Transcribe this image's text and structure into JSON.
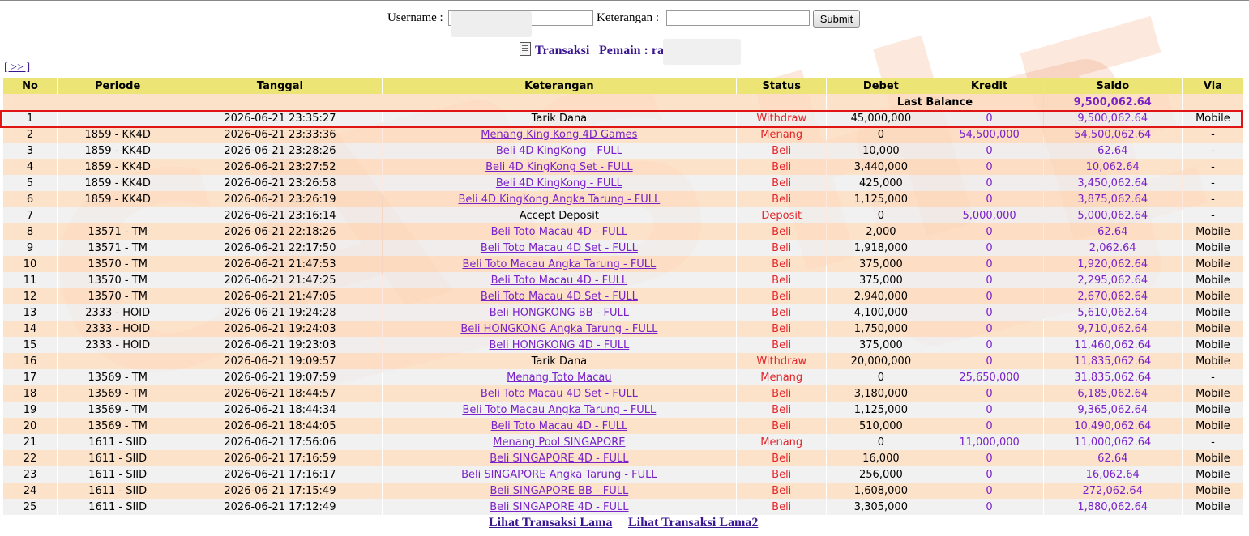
{
  "form": {
    "username_label": "Username :",
    "keterangan_label": "Keterangan :",
    "submit_label": "Submit"
  },
  "heading": {
    "transaksi": "Transaksi",
    "pemain": "Pemain : ra"
  },
  "nav": {
    "next": "[ >> ]"
  },
  "table": {
    "headers": [
      "No",
      "Periode",
      "Tanggal",
      "Keterangan",
      "Status",
      "Debet",
      "Kredit",
      "Saldo",
      "Via"
    ],
    "last_balance_label": "Last Balance",
    "last_balance_value": "9,500,062.64",
    "rows": [
      {
        "no": "1",
        "periode": "",
        "tanggal": "2026-06-21 23:35:27",
        "keterangan": "Tarik Dana",
        "link": false,
        "status": "Withdraw",
        "debet": "45,000,000",
        "kredit": "0",
        "saldo": "9,500,062.64",
        "via": "Mobile"
      },
      {
        "no": "2",
        "periode": "1859 - KK4D",
        "tanggal": "2026-06-21 23:33:36",
        "keterangan": "Menang King Kong 4D Games",
        "link": true,
        "status": "Menang",
        "debet": "0",
        "kredit": "54,500,000",
        "saldo": "54,500,062.64",
        "via": "-"
      },
      {
        "no": "3",
        "periode": "1859 - KK4D",
        "tanggal": "2026-06-21 23:28:26",
        "keterangan": "Beli 4D KingKong - FULL",
        "link": true,
        "status": "Beli",
        "debet": "10,000",
        "kredit": "0",
        "saldo": "62.64",
        "via": "-"
      },
      {
        "no": "4",
        "periode": "1859 - KK4D",
        "tanggal": "2026-06-21 23:27:52",
        "keterangan": "Beli 4D KingKong Set - FULL",
        "link": true,
        "status": "Beli",
        "debet": "3,440,000",
        "kredit": "0",
        "saldo": "10,062.64",
        "via": "-"
      },
      {
        "no": "5",
        "periode": "1859 - KK4D",
        "tanggal": "2026-06-21 23:26:58",
        "keterangan": "Beli 4D KingKong - FULL",
        "link": true,
        "status": "Beli",
        "debet": "425,000",
        "kredit": "0",
        "saldo": "3,450,062.64",
        "via": "-"
      },
      {
        "no": "6",
        "periode": "1859 - KK4D",
        "tanggal": "2026-06-21 23:26:19",
        "keterangan": "Beli 4D KingKong Angka Tarung - FULL",
        "link": true,
        "status": "Beli",
        "debet": "1,125,000",
        "kredit": "0",
        "saldo": "3,875,062.64",
        "via": "-"
      },
      {
        "no": "7",
        "periode": "",
        "tanggal": "2026-06-21 23:16:14",
        "keterangan": "Accept Deposit",
        "link": false,
        "status": "Deposit",
        "debet": "0",
        "kredit": "5,000,000",
        "saldo": "5,000,062.64",
        "via": "-"
      },
      {
        "no": "8",
        "periode": "13571 - TM",
        "tanggal": "2026-06-21 22:18:26",
        "keterangan": "Beli Toto Macau 4D - FULL",
        "link": true,
        "status": "Beli",
        "debet": "2,000",
        "kredit": "0",
        "saldo": "62.64",
        "via": "Mobile"
      },
      {
        "no": "9",
        "periode": "13571 - TM",
        "tanggal": "2026-06-21 22:17:50",
        "keterangan": "Beli Toto Macau 4D Set - FULL",
        "link": true,
        "status": "Beli",
        "debet": "1,918,000",
        "kredit": "0",
        "saldo": "2,062.64",
        "via": "Mobile"
      },
      {
        "no": "10",
        "periode": "13570 - TM",
        "tanggal": "2026-06-21 21:47:53",
        "keterangan": "Beli Toto Macau Angka Tarung - FULL",
        "link": true,
        "status": "Beli",
        "debet": "375,000",
        "kredit": "0",
        "saldo": "1,920,062.64",
        "via": "Mobile"
      },
      {
        "no": "11",
        "periode": "13570 - TM",
        "tanggal": "2026-06-21 21:47:25",
        "keterangan": "Beli Toto Macau 4D - FULL",
        "link": true,
        "status": "Beli",
        "debet": "375,000",
        "kredit": "0",
        "saldo": "2,295,062.64",
        "via": "Mobile"
      },
      {
        "no": "12",
        "periode": "13570 - TM",
        "tanggal": "2026-06-21 21:47:05",
        "keterangan": "Beli Toto Macau 4D Set - FULL",
        "link": true,
        "status": "Beli",
        "debet": "2,940,000",
        "kredit": "0",
        "saldo": "2,670,062.64",
        "via": "Mobile"
      },
      {
        "no": "13",
        "periode": "2333 - HOID",
        "tanggal": "2026-06-21 19:24:28",
        "keterangan": "Beli HONGKONG BB - FULL",
        "link": true,
        "status": "Beli",
        "debet": "4,100,000",
        "kredit": "0",
        "saldo": "5,610,062.64",
        "via": "Mobile"
      },
      {
        "no": "14",
        "periode": "2333 - HOID",
        "tanggal": "2026-06-21 19:24:03",
        "keterangan": "Beli HONGKONG Angka Tarung - FULL",
        "link": true,
        "status": "Beli",
        "debet": "1,750,000",
        "kredit": "0",
        "saldo": "9,710,062.64",
        "via": "Mobile"
      },
      {
        "no": "15",
        "periode": "2333 - HOID",
        "tanggal": "2026-06-21 19:23:03",
        "keterangan": "Beli HONGKONG 4D - FULL",
        "link": true,
        "status": "Beli",
        "debet": "375,000",
        "kredit": "0",
        "saldo": "11,460,062.64",
        "via": "Mobile"
      },
      {
        "no": "16",
        "periode": "",
        "tanggal": "2026-06-21 19:09:57",
        "keterangan": "Tarik Dana",
        "link": false,
        "status": "Withdraw",
        "debet": "20,000,000",
        "kredit": "0",
        "saldo": "11,835,062.64",
        "via": "Mobile"
      },
      {
        "no": "17",
        "periode": "13569 - TM",
        "tanggal": "2026-06-21 19:07:59",
        "keterangan": "Menang Toto Macau",
        "link": true,
        "status": "Menang",
        "debet": "0",
        "kredit": "25,650,000",
        "saldo": "31,835,062.64",
        "via": "-"
      },
      {
        "no": "18",
        "periode": "13569 - TM",
        "tanggal": "2026-06-21 18:44:57",
        "keterangan": "Beli Toto Macau 4D Set - FULL",
        "link": true,
        "status": "Beli",
        "debet": "3,180,000",
        "kredit": "0",
        "saldo": "6,185,062.64",
        "via": "Mobile"
      },
      {
        "no": "19",
        "periode": "13569 - TM",
        "tanggal": "2026-06-21 18:44:34",
        "keterangan": "Beli Toto Macau Angka Tarung - FULL",
        "link": true,
        "status": "Beli",
        "debet": "1,125,000",
        "kredit": "0",
        "saldo": "9,365,062.64",
        "via": "Mobile"
      },
      {
        "no": "20",
        "periode": "13569 - TM",
        "tanggal": "2026-06-21 18:44:05",
        "keterangan": "Beli Toto Macau 4D - FULL",
        "link": true,
        "status": "Beli",
        "debet": "510,000",
        "kredit": "0",
        "saldo": "10,490,062.64",
        "via": "Mobile"
      },
      {
        "no": "21",
        "periode": "1611 - SIID",
        "tanggal": "2026-06-21 17:56:06",
        "keterangan": "Menang Pool SINGAPORE",
        "link": true,
        "status": "Menang",
        "debet": "0",
        "kredit": "11,000,000",
        "saldo": "11,000,062.64",
        "via": "-"
      },
      {
        "no": "22",
        "periode": "1611 - SIID",
        "tanggal": "2026-06-21 17:16:59",
        "keterangan": "Beli SINGAPORE 4D - FULL",
        "link": true,
        "status": "Beli",
        "debet": "16,000",
        "kredit": "0",
        "saldo": "62.64",
        "via": "Mobile"
      },
      {
        "no": "23",
        "periode": "1611 - SIID",
        "tanggal": "2026-06-21 17:16:17",
        "keterangan": "Beli SINGAPORE Angka Tarung - FULL",
        "link": true,
        "status": "Beli",
        "debet": "256,000",
        "kredit": "0",
        "saldo": "16,062.64",
        "via": "Mobile"
      },
      {
        "no": "24",
        "periode": "1611 - SIID",
        "tanggal": "2026-06-21 17:15:49",
        "keterangan": "Beli SINGAPORE BB - FULL",
        "link": true,
        "status": "Beli",
        "debet": "1,608,000",
        "kredit": "0",
        "saldo": "272,062.64",
        "via": "Mobile"
      },
      {
        "no": "25",
        "periode": "1611 - SIID",
        "tanggal": "2026-06-21 17:12:49",
        "keterangan": "Beli SINGAPORE 4D - FULL",
        "link": true,
        "status": "Beli",
        "debet": "3,305,000",
        "kredit": "0",
        "saldo": "1,880,062.64",
        "via": "Mobile"
      }
    ]
  },
  "footer": {
    "link1": "Lihat Transaksi Lama",
    "link2": "Lihat Transaksi Lama2"
  },
  "colors": {
    "header_bg": "#ece575",
    "row_odd": "#eeeeee",
    "row_even": "#fddcbe",
    "link": "#7a22c8",
    "status": "#e3262a",
    "highlight": "#e01515"
  },
  "icons": {
    "heading_icon": "document-icon"
  }
}
